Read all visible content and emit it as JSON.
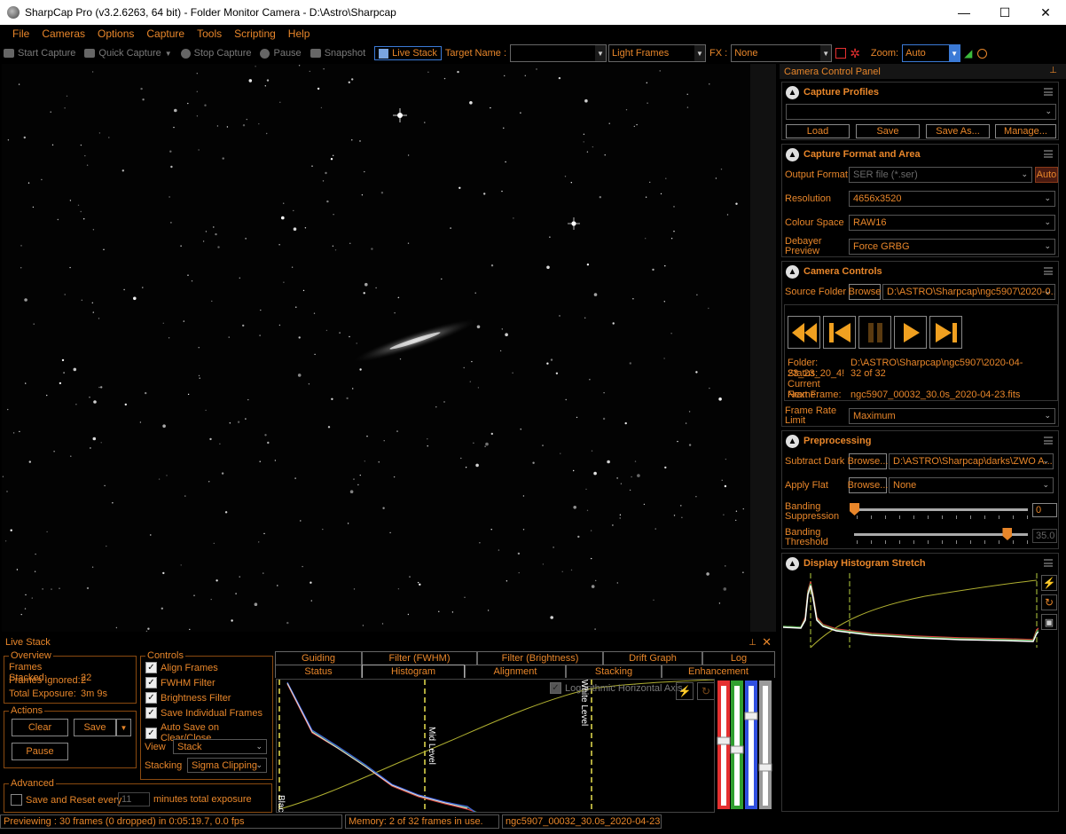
{
  "window": {
    "title": "SharpCap Pro (v3.2.6263, 64 bit) - Folder Monitor Camera - D:\\Astro\\Sharpcap",
    "minimize": "—",
    "maximize": "☐",
    "close": "✕"
  },
  "menu": [
    "File",
    "Cameras",
    "Options",
    "Capture",
    "Tools",
    "Scripting",
    "Help"
  ],
  "toolbar": {
    "start_capture": "Start Capture",
    "quick_capture": "Quick Capture",
    "stop_capture": "Stop Capture",
    "pause": "Pause",
    "snapshot": "Snapshot",
    "live_stack": "Live Stack",
    "target_name_label": "Target Name :",
    "target_name_value": "",
    "frame_type": "Light Frames",
    "fx_label": "FX :",
    "fx_value": "None",
    "zoom_label": "Zoom:",
    "zoom_value": "Auto"
  },
  "right_panel": {
    "title": "Camera Control Panel",
    "pin": "⊥",
    "capture_profiles": {
      "title": "Capture Profiles",
      "profile_value": "",
      "load": "Load",
      "save": "Save",
      "save_as": "Save As...",
      "manage": "Manage..."
    },
    "capture_format": {
      "title": "Capture Format and Area",
      "output_format_label": "Output Format",
      "output_format_value": "SER file (*.ser)",
      "auto": "Auto",
      "resolution_label": "Resolution",
      "resolution_value": "4656x3520",
      "colour_space_label": "Colour Space",
      "colour_space_value": "RAW16",
      "debayer_label": "Debayer Preview",
      "debayer_value": "Force GRBG"
    },
    "camera_controls": {
      "title": "Camera Controls",
      "source_folder_label": "Source Folder",
      "browse": "Browse",
      "source_folder_value": "D:\\ASTRO\\Sharpcap\\ngc5907\\2020-0...",
      "folder_label": "Folder:",
      "folder_value": "D:\\ASTRO\\Sharpcap\\ngc5907\\2020-04-23_23_20_4!",
      "status_label": "Status:",
      "status_value": "32 of 32",
      "current_frame_label": "Current Frame:",
      "current_frame_value": "ngc5907_00032_30.0s_2020-04-23.fits",
      "next_frame_label": "Next Frame:",
      "next_frame_value": "",
      "frame_rate_label": "Frame Rate Limit",
      "frame_rate_value": "Maximum"
    },
    "preprocessing": {
      "title": "Preprocessing",
      "subtract_dark_label": "Subtract Dark",
      "browse": "Browse...",
      "subtract_dark_value": "D:\\ASTRO\\Sharpcap\\darks\\ZWO A...",
      "apply_flat_label": "Apply Flat",
      "apply_flat_value": "None",
      "banding_suppression_label": "Banding Suppression",
      "banding_suppression_value": "0",
      "banding_suppression_level": 0,
      "banding_threshold_label": "Banding Threshold",
      "banding_threshold_value": "35.0",
      "banding_threshold_level": 0.88
    },
    "display_histogram": {
      "title": "Display Histogram Stretch"
    }
  },
  "live_stack": {
    "title": "Live Stack",
    "overview": {
      "label": "Overview",
      "frames_stacked_label": "Frames Stacked:",
      "frames_stacked": "22",
      "frames_ignored_label": "Frames Ignored:",
      "frames_ignored": "2",
      "total_exposure_label": "Total Exposure:",
      "total_exposure": "3m 9s"
    },
    "actions": {
      "label": "Actions",
      "clear": "Clear",
      "save": "Save",
      "pause": "Pause"
    },
    "advanced": {
      "label": "Advanced",
      "save_reset_label": "Save and Reset every",
      "save_reset_value": "11",
      "minutes_label": "minutes total exposure"
    },
    "controls": {
      "label": "Controls",
      "align_frames": "Align Frames",
      "fwhm_filter": "FWHM Filter",
      "brightness_filter": "Brightness Filter",
      "save_individual": "Save Individual Frames",
      "auto_save": "Auto Save on Clear/Close",
      "view_label": "View",
      "view_value": "Stack",
      "stacking_label": "Stacking",
      "stacking_value": "Sigma Clipping"
    },
    "tabs_top": [
      "Guiding",
      "Filter (FWHM)",
      "Filter (Brightness)",
      "Drift Graph",
      "Log"
    ],
    "tabs_bottom": [
      "Status",
      "Histogram",
      "Alignment",
      "Stacking",
      "Enhancement"
    ],
    "histogram": {
      "log_axis_label": "Logarithmic Horizontal Axis",
      "black_level": "Black Level",
      "mid_level": "Mid Level",
      "white_level": "White Level"
    }
  },
  "status_bar": {
    "preview": "Previewing : 30 frames (0 dropped) in 0:05:19.7, 0.0 fps",
    "memory": "Memory: 2 of 32 frames in use.",
    "file": "ngc5907_00032_30.0s_2020-04-23.fits"
  },
  "colors": {
    "accent": "#e8862a",
    "background": "#000000",
    "highlight": "#3b7ad6"
  }
}
